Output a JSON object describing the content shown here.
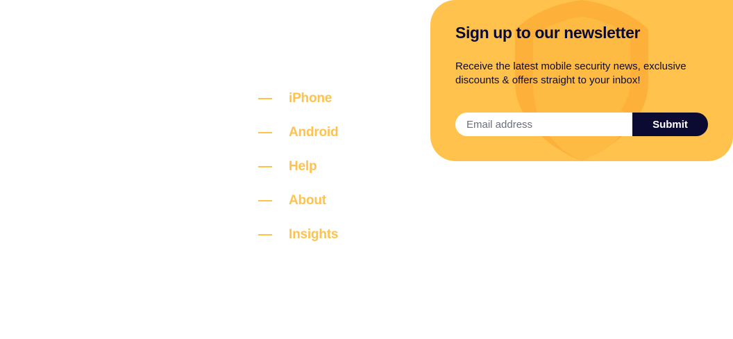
{
  "nav": {
    "items": [
      {
        "label": "iPhone"
      },
      {
        "label": "Android"
      },
      {
        "label": "Help"
      },
      {
        "label": "About"
      },
      {
        "label": "Insights"
      }
    ]
  },
  "newsletter": {
    "title": "Sign up to our newsletter",
    "description": "Receive the latest mobile security news, exclusive discounts & offers straight to your inbox!",
    "email_placeholder": "Email address",
    "submit_label": "Submit",
    "background_icon": "shield-icon"
  },
  "colors": {
    "accent": "#ffc24c",
    "accent_dark": "#fdb13a",
    "navy": "#0a0a32",
    "white": "#ffffff"
  }
}
